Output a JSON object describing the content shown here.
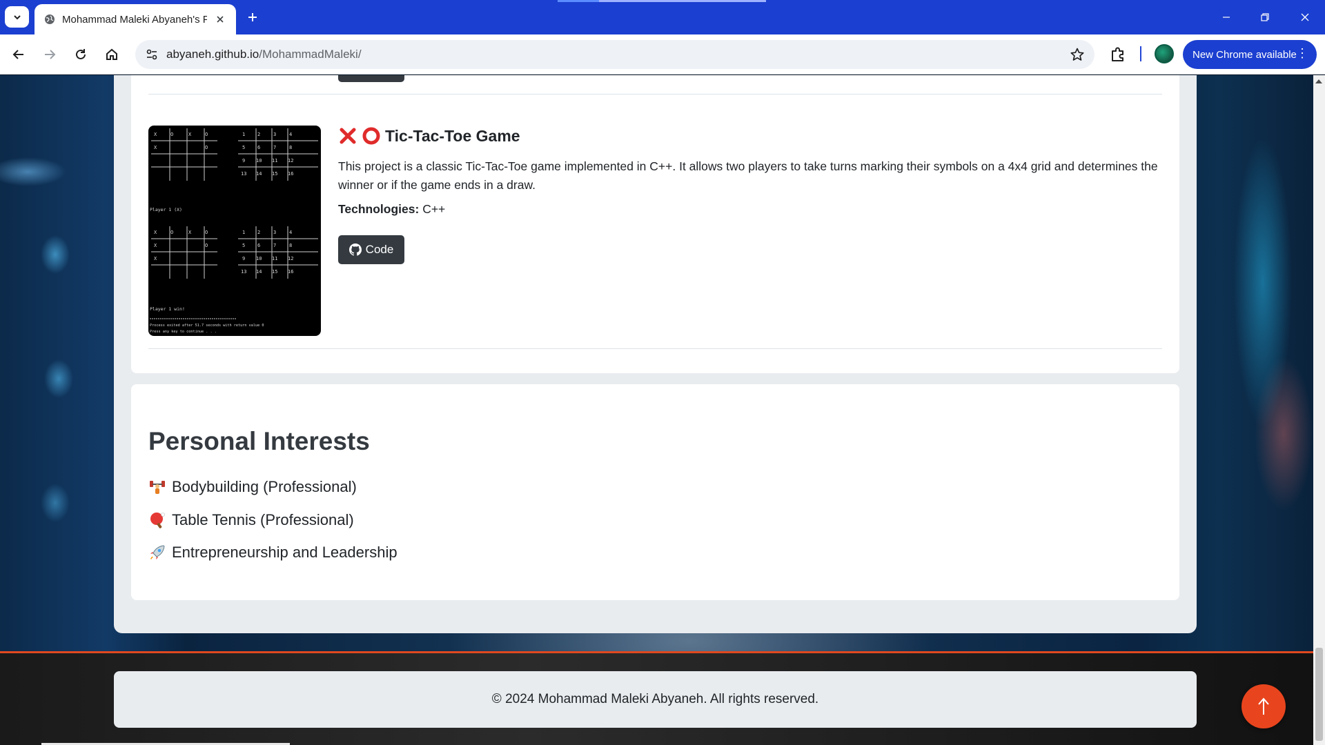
{
  "browser": {
    "tab_title": "Mohammad Maleki Abyaneh's Portfolio",
    "url_host": "abyaneh.github.io",
    "url_path": "/MohammadMaleki/",
    "update_label": "New Chrome available",
    "icons": {
      "tab_search": "chevron-down-icon",
      "favicon": "globe-icon",
      "tab_close": "close-icon",
      "new_tab": "plus-icon",
      "back": "arrow-left-icon",
      "forward": "arrow-right-icon",
      "reload": "reload-icon",
      "home": "home-icon",
      "site_info": "tune-icon",
      "bookmark": "star-icon",
      "extensions": "puzzle-icon",
      "menu": "kebab-icon"
    },
    "colors": {
      "titlebar": "#1b3fd0",
      "update_button": "#1b3fd0"
    }
  },
  "project": {
    "title": "Tic-Tac-Toe Game",
    "title_emojis": [
      "cross-mark-icon",
      "circle-icon"
    ],
    "description": "This project is a classic Tic-Tac-Toe game implemented in C++. It allows two players to take turns marking their symbols on a 4x4 grid and determines the winner or if the game ends in a draw.",
    "tech_label": "Technologies:",
    "tech_value": "C++",
    "code_button_label": "Code",
    "code_button_icon": "github-icon",
    "thumbnail": {
      "player_line_1": "Player 1 (X)",
      "player_line_2": "Player 1 win!",
      "process_line": "Process exited after 51.7 seconds with return value 0",
      "press_line": "Press any key to continue . . ."
    }
  },
  "interests": {
    "heading": "Personal Interests",
    "items": [
      {
        "icon": "weightlifting-icon",
        "label": "Bodybuilding (Professional)"
      },
      {
        "icon": "ping-pong-icon",
        "label": "Table Tennis (Professional)"
      },
      {
        "icon": "rocket-icon",
        "label": "Entrepreneurship and Leadership"
      }
    ]
  },
  "footer": {
    "copyright": "© 2024 Mohammad Maleki Abyaneh. All rights reserved.",
    "back_to_top_icon": "arrow-up-icon",
    "accent": "#e8451e"
  }
}
